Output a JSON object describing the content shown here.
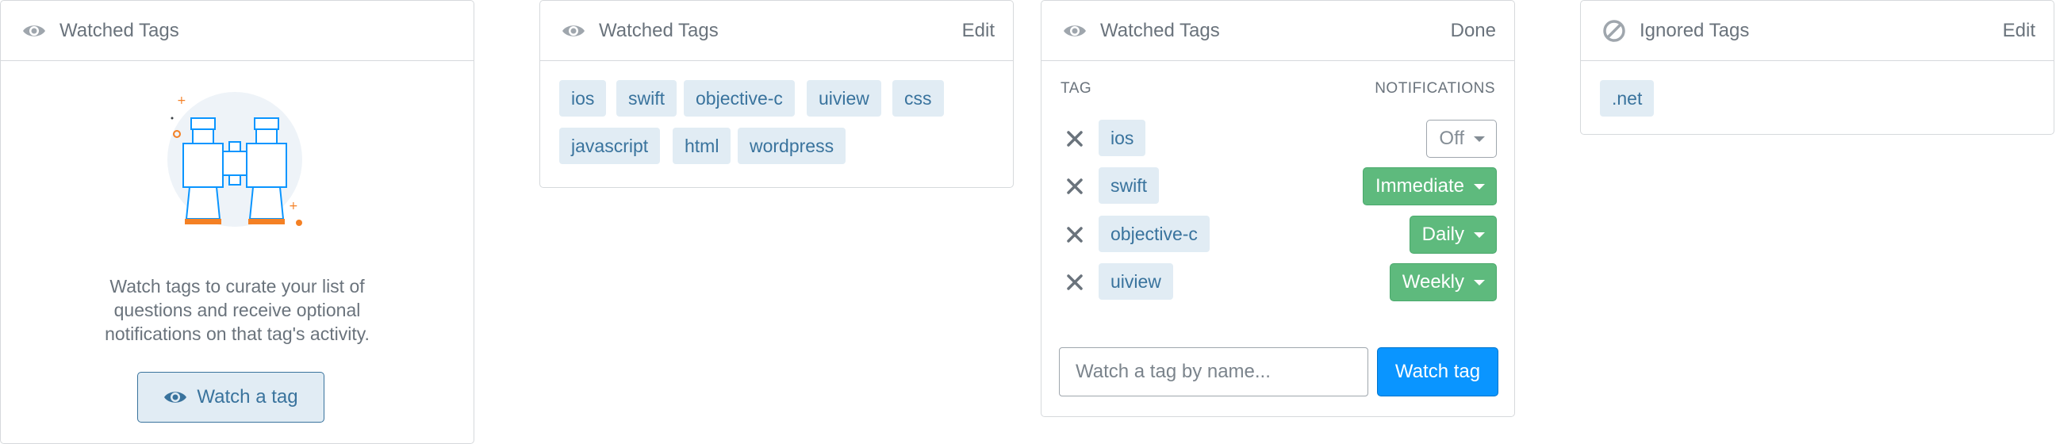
{
  "panels": {
    "watched_empty": {
      "title": "Watched Tags",
      "icon": "eye-icon",
      "description_lines": [
        "Watch tags to curate your list of",
        "questions and receive optional",
        "notifications on that tag's activity."
      ],
      "button_label": "Watch a tag"
    },
    "watched_list": {
      "title": "Watched Tags",
      "icon": "eye-icon",
      "action": "Edit",
      "tags": [
        "ios",
        "swift",
        "objective-c",
        "uiview",
        "css",
        "javascript",
        "html",
        "wordpress"
      ]
    },
    "watched_edit": {
      "title": "Watched Tags",
      "icon": "eye-icon",
      "action": "Done",
      "col_tag": "TAG",
      "col_notifications": "NOTIFICATIONS",
      "rows": [
        {
          "tag": "ios",
          "notification": "Off"
        },
        {
          "tag": "swift",
          "notification": "Immediate"
        },
        {
          "tag": "objective-c",
          "notification": "Daily"
        },
        {
          "tag": "uiview",
          "notification": "Weekly"
        }
      ],
      "input_placeholder": "Watch a tag by name...",
      "submit_label": "Watch tag"
    },
    "ignored": {
      "title": "Ignored Tags",
      "icon": "ban-icon",
      "action": "Edit",
      "tags": [
        ".net"
      ]
    }
  },
  "colors": {
    "tag_bg": "#e1ecf4",
    "tag_text": "#39739d",
    "notify_on": "#5eba7d",
    "primary_button": "#0a95ff"
  }
}
